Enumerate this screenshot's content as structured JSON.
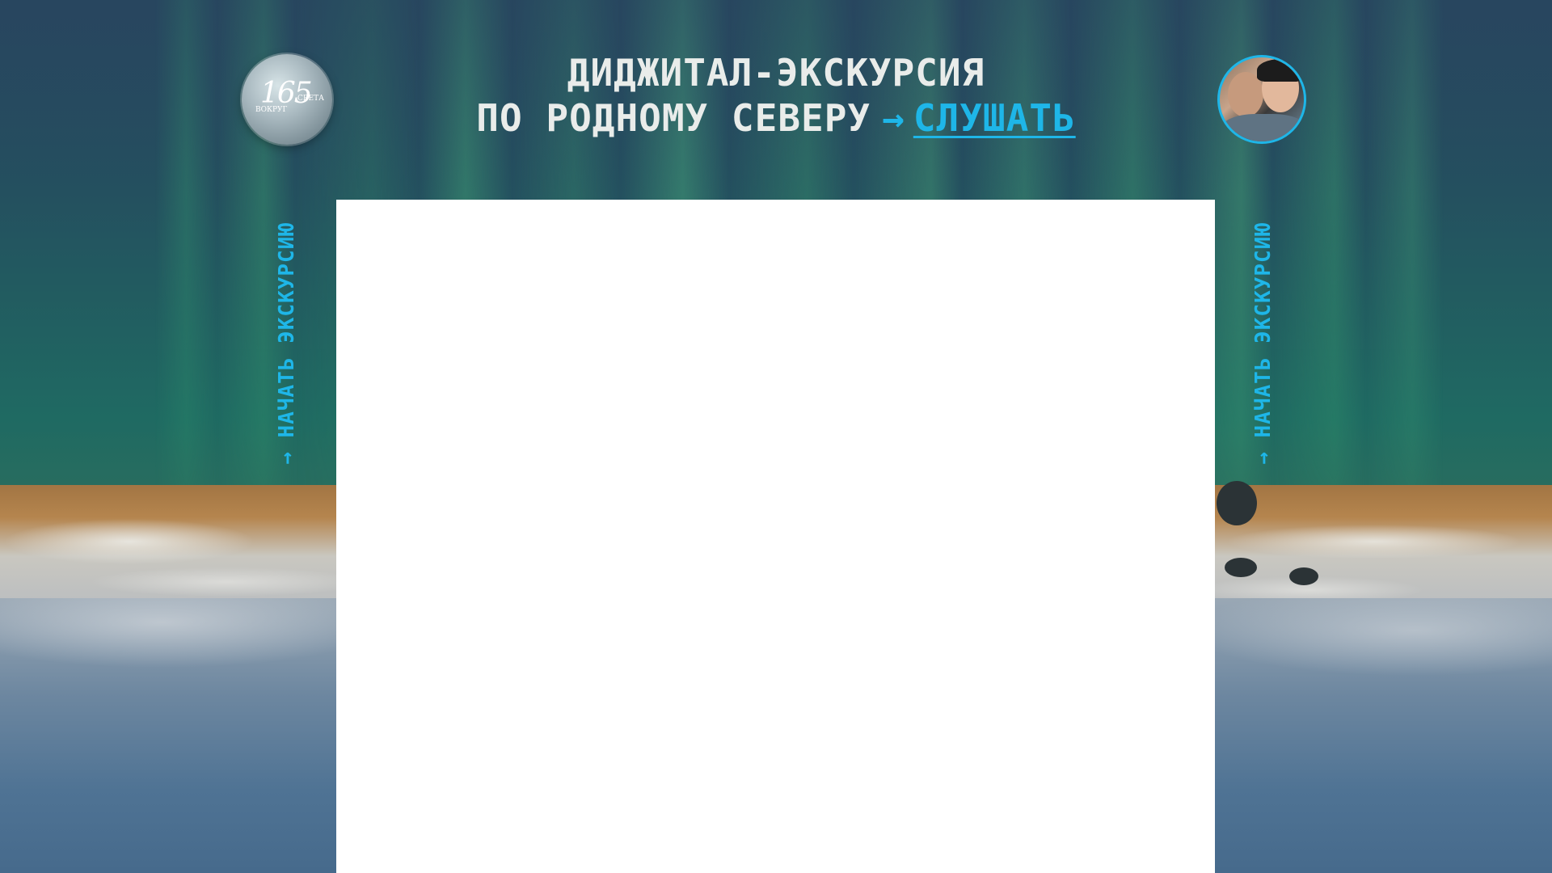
{
  "header": {
    "logo": {
      "number": "165",
      "text_left": "ВОКРУГ",
      "text_right": "СВЕТА"
    },
    "title_line1": "ДИДЖИТАЛ-ЭКСКУРСИЯ",
    "title_line2": "ПО РОДНОМУ СЕВЕРУ",
    "arrow": "→",
    "listen_link": "СЛУШАТЬ"
  },
  "side_links": {
    "left": "→ НАЧАТЬ ЭКСКУРСИЮ",
    "right": "→ НАЧАТЬ ЭКСКУРСИЮ"
  },
  "colors": {
    "accent": "#1eb6e8",
    "title_text": "#e9ecea",
    "content_bg": "#ffffff"
  },
  "icons": {
    "avatar": "narrators-avatar-photo",
    "logo": "vokrug-sveta-165-logo"
  }
}
